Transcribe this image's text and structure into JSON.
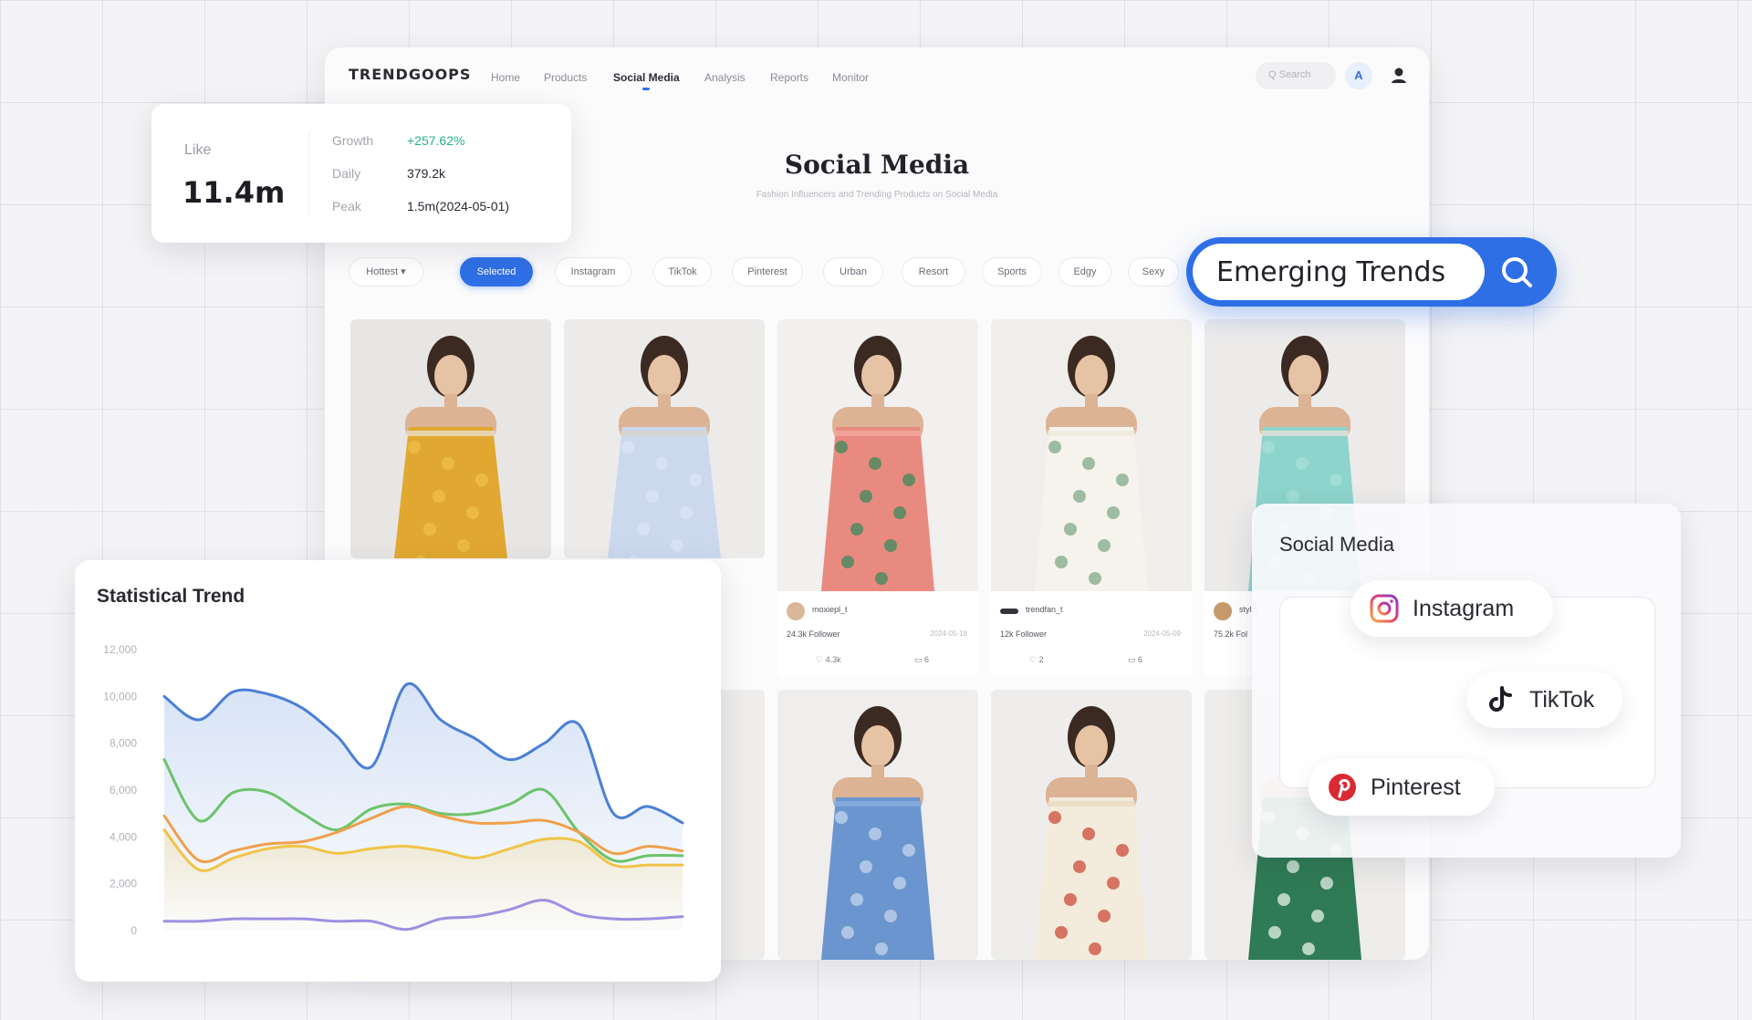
{
  "app": {
    "logo": "TRENDGOOPS",
    "nav": [
      "Home",
      "Products",
      "Social Media",
      "Analysis",
      "Reports",
      "Monitor"
    ],
    "active_nav": 2,
    "search_placeholder": "Q Search",
    "translate_icon": "translate-icon"
  },
  "page": {
    "title": "Social Media",
    "subtitle": "Fashion Influencers and Trending Products on Social Media"
  },
  "filters": {
    "sort": "Hottest ▾",
    "chips": [
      "Selected",
      "Instagram",
      "TikTok",
      "Pinterest",
      "Urban",
      "Resort",
      "Sports",
      "Edgy",
      "Sexy"
    ],
    "active": 0
  },
  "emerging_search": {
    "value": "Emerging Trends",
    "icon": "search-icon"
  },
  "like_stats": {
    "label": "Like",
    "value": "11.4m",
    "rows": [
      {
        "label": "Growth",
        "value": "+257.62%"
      },
      {
        "label": "Daily",
        "value": "379.2k"
      },
      {
        "label": "Peak",
        "value": "1.5m(2024-05-01)"
      }
    ]
  },
  "products": [
    {
      "name": "yellow crop top",
      "palette": [
        "#e8e6e4",
        "#e0a830",
        "#f0c04a",
        "#e9dfcf"
      ]
    },
    {
      "name": "light blue tube top",
      "palette": [
        "#ecebea",
        "#cbd8ee",
        "#dbe5f5",
        "#d8d4cc"
      ]
    },
    {
      "name": "floral halter dress",
      "palette": [
        "#f1f0ee",
        "#e98a80",
        "#3a8a5a",
        "#f2a79b"
      ],
      "user": "moxiepl_t",
      "followers": "24.3k Follower",
      "date": "2024-05-18",
      "likes": "♡ 4.3k",
      "comments": "▭ 6"
    },
    {
      "name": "white midi dress",
      "palette": [
        "#efeeeb",
        "#f5f3ec",
        "#7fa98a",
        "#efeadd"
      ],
      "user": "trendfan_t",
      "followers": "12k Follower",
      "date": "2024-05-09",
      "likes": "♡ 2",
      "comments": "▭ 6"
    },
    {
      "name": "mint tee",
      "palette": [
        "#ecebea",
        "#8dd4cc",
        "#a5e0d8",
        "#e6e1da"
      ],
      "user": "stylis",
      "followers": "75.2k Fol",
      "date": "",
      "likes": "",
      "comments": ""
    },
    {
      "name": "blue paisley dress",
      "palette": [
        "#efeeec",
        "#6b95cf",
        "#c4d6ee",
        "#8aaee0"
      ]
    },
    {
      "name": "printed camp shirt",
      "palette": [
        "#eeedeb",
        "#f3ebdb",
        "#cc4b3a",
        "#e8d9c2"
      ]
    },
    {
      "name": "green floral wrap",
      "palette": [
        "#eeedeb",
        "#2f7b55",
        "#e7f1e8",
        "#1f6646"
      ]
    }
  ],
  "social_platforms": {
    "title": "Social Media",
    "items": [
      {
        "name": "Instagram",
        "icon": "instagram-icon"
      },
      {
        "name": "TikTok",
        "icon": "tiktok-icon"
      },
      {
        "name": "Pinterest",
        "icon": "pinterest-icon"
      }
    ]
  },
  "chart_data": {
    "type": "area",
    "title": "Statistical Trend",
    "xlabel": "",
    "ylabel": "",
    "ylim": [
      0,
      12000
    ],
    "yticks": [
      "12,000",
      "10,000",
      "8,000",
      "6,000",
      "4,000",
      "2,000",
      "0"
    ],
    "x": [
      0,
      1,
      2,
      3,
      4,
      5,
      6,
      7,
      8,
      9,
      10,
      11,
      12,
      13,
      14,
      15
    ],
    "grid": false,
    "legend": "none",
    "series": [
      {
        "color": "#4a7fd6",
        "fill": true,
        "values": [
          10000,
          9000,
          10200,
          10100,
          9500,
          8300,
          7000,
          10500,
          9000,
          8200,
          7300,
          8000,
          8800,
          5000,
          5300,
          4600
        ]
      },
      {
        "color": "#6cc36a",
        "fill": false,
        "values": [
          7300,
          4700,
          5900,
          5900,
          5000,
          4300,
          5200,
          5400,
          5000,
          5000,
          5400,
          6000,
          4200,
          3000,
          3200,
          3200
        ]
      },
      {
        "color": "#f0a04b",
        "fill": false,
        "values": [
          4900,
          3000,
          3400,
          3700,
          3800,
          4200,
          4800,
          5300,
          4900,
          4600,
          4600,
          4700,
          4200,
          3300,
          3600,
          3400
        ]
      },
      {
        "color": "#f1c447",
        "fill": true,
        "values": [
          4300,
          2600,
          3100,
          3500,
          3600,
          3300,
          3500,
          3600,
          3400,
          3100,
          3500,
          3900,
          3800,
          2800,
          2800,
          2800
        ]
      },
      {
        "color": "#9f8fe0",
        "fill": false,
        "values": [
          400,
          400,
          500,
          500,
          500,
          400,
          400,
          50,
          500,
          600,
          900,
          1300,
          700,
          500,
          500,
          600
        ]
      }
    ]
  }
}
